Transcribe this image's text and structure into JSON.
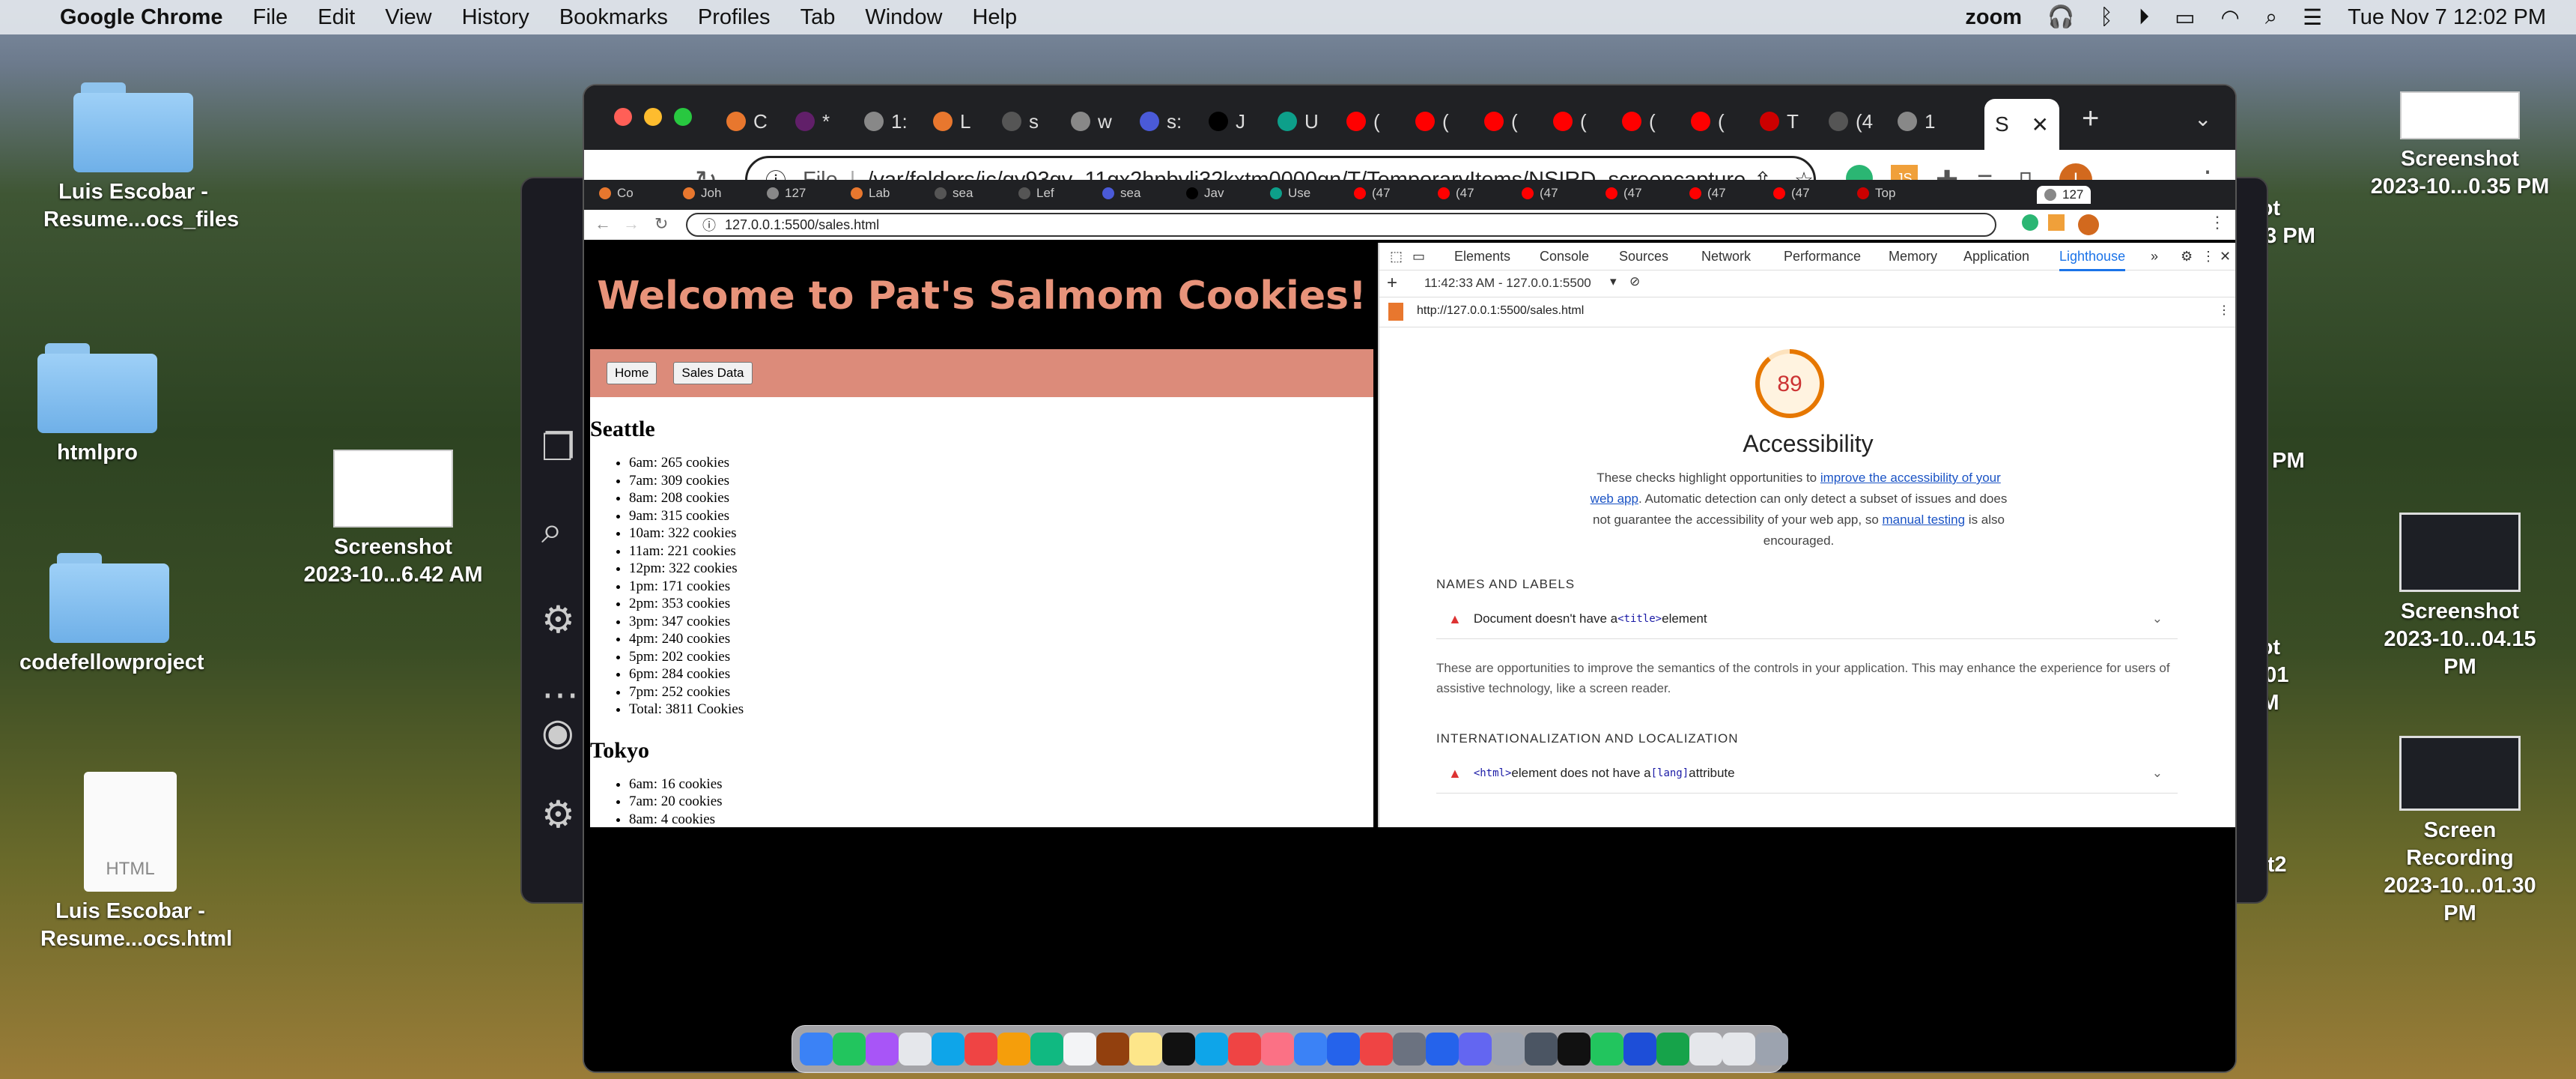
{
  "menubar": {
    "app_name": "Google Chrome",
    "menus": [
      "File",
      "Edit",
      "View",
      "History",
      "Bookmarks",
      "Profiles",
      "Tab",
      "Window",
      "Help"
    ],
    "zoom_label": "zoom",
    "datetime": "Tue Nov 7  12:02 PM"
  },
  "desktop": {
    "icons": [
      {
        "label_1": "Luis Escobar -",
        "label_2": "Resume...ocs_files"
      },
      {
        "label_1": "htmlpro"
      },
      {
        "label_1": "codefellowproject"
      },
      {
        "label_1": "Luis Escobar -",
        "label_2": "Resume...ocs.html",
        "file_badge": "HTML"
      },
      {
        "label_1": "Screenshot",
        "label_2": "2023-10...6.42 AM"
      },
      {
        "label_1": "Screenshot",
        "label_2": "2023-10...0.35 PM"
      },
      {
        "label_1": "Screenshot",
        "label_2": "2023-10...04.15 PM"
      },
      {
        "label_1": "Screen Recording",
        "label_2": "2023-10...01.30 PM"
      }
    ],
    "partial_labels": [
      "hot",
      ".43 PM",
      "t",
      "5 PM",
      "hot",
      "6.01 PM",
      "ot2"
    ]
  },
  "chrome": {
    "tabs": [
      "C",
      "*",
      "1:",
      "L",
      "s",
      "w",
      "s:",
      "J",
      "U",
      "(",
      "(",
      "(",
      "(",
      "(",
      "(",
      "T",
      "(4",
      "1"
    ],
    "active_tab": "S",
    "omnibox_scheme": "File",
    "omnibox_url": "/var/folders/jc/gy93gv_11gx2hpbvlj32kxtm0000gn/T/TemporaryItems/NSIRD_screencapture...",
    "profile_initial": "I",
    "ext_js": "JS"
  },
  "inner_chrome": {
    "tabs": [
      "Co",
      "Joh",
      "127",
      "Lab",
      "sea",
      "Lef",
      "sea",
      "Jav",
      "Use",
      "(47",
      "(47",
      "(47",
      "(47",
      "(47",
      "(47",
      "Top",
      "127"
    ],
    "url": "127.0.0.1:5500/sales.html"
  },
  "page": {
    "title": "Welcome to Pat's Salmom Cookies!",
    "nav": [
      "Home",
      "Sales Data"
    ],
    "seattle": {
      "name": "Seattle",
      "rows": [
        "6am: 265 cookies",
        "7am: 309 cookies",
        "8am: 208 cookies",
        "9am: 315 cookies",
        "10am: 322 cookies",
        "11am: 221 cookies",
        "12pm: 322 cookies",
        "1pm: 171 cookies",
        "2pm: 353 cookies",
        "3pm: 347 cookies",
        "4pm: 240 cookies",
        "5pm: 202 cookies",
        "6pm: 284 cookies",
        "7pm: 252 cookies",
        "Total: 3811 Cookies"
      ]
    },
    "tokyo": {
      "name": "Tokyo",
      "rows": [
        "6am: 16 cookies",
        "7am: 20 cookies",
        "8am: 4 cookies"
      ]
    }
  },
  "devtools": {
    "tabs": [
      "Elements",
      "Console",
      "Sources",
      "Network",
      "Performance",
      "Memory",
      "Application",
      "Lighthouse"
    ],
    "report_time": "11:42:33 AM - 127.0.0.1:5500",
    "report_url": "http://127.0.0.1:5500/sales.html",
    "score": "89",
    "score_fraction": 0.89,
    "category": "Accessibility",
    "desc_1": "These checks highlight opportunities to ",
    "desc_link_1": "improve the accessibility of your web app",
    "desc_2": ". Automatic detection can only detect a subset of issues and does not guarantee the accessibility of your web app, so ",
    "desc_link_2": "manual testing",
    "desc_3": " is also encouraged.",
    "section_1": "NAMES AND LABELS",
    "audit_1_pre": "Document doesn't have a ",
    "audit_1_code": "<title>",
    "audit_1_post": " element",
    "opportunity_text": "These are opportunities to improve the semantics of the controls in your application. This may enhance the experience for users of assistive technology, like a screen reader.",
    "section_2": "INTERNATIONALIZATION AND LOCALIZATION",
    "audit_2_code": "<html>",
    "audit_2_mid": " element does not have a ",
    "audit_2_code2": "[lang]",
    "audit_2_post": " attribute"
  },
  "colors": {
    "header_text": "#e8937a",
    "nav_bar": "#dc8b7a",
    "score_orange": "#e67700"
  }
}
